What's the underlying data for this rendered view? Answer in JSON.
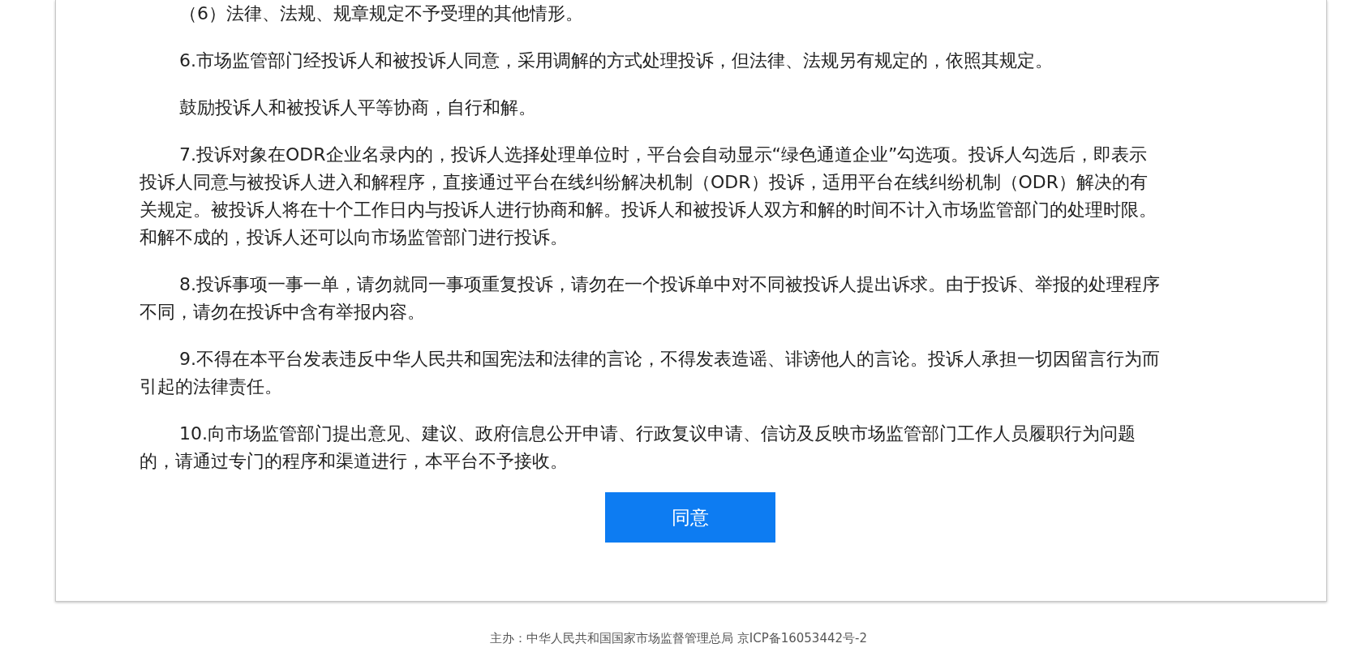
{
  "paragraphs": [
    {
      "lines": [
        "（6）法律、法规、规章规定不予受理的其他情形。"
      ]
    },
    {
      "lines": [
        "6.市场监管部门经投诉人和被投诉人同意，采用调解的方式处理投诉，但法律、法规另有规定的，依照其规定。"
      ]
    },
    {
      "lines": [
        "鼓励投诉人和被投诉人平等协商，自行和解。"
      ]
    },
    {
      "lines": [
        "7.投诉对象在ODR企业名录内的，投诉人选择处理单位时，平台会自动显示“绿色通道企业”勾选项。投诉人勾选后，即表示",
        "投诉人同意与被投诉人进入和解程序，直接通过平台在线纠纷解决机制（ODR）投诉，适用平台在线纠纷机制（ODR）解决的有",
        "关规定。被投诉人将在十个工作日内与投诉人进行协商和解。投诉人和被投诉人双方和解的时间不计入市场监管部门的处理时限。",
        "和解不成的，投诉人还可以向市场监管部门进行投诉。"
      ]
    },
    {
      "lines": [
        "8.投诉事项一事一单，请勿就同一事项重复投诉，请勿在一个投诉单中对不同被投诉人提出诉求。由于投诉、举报的处理程序",
        "不同，请勿在投诉中含有举报内容。"
      ]
    },
    {
      "lines": [
        "9.不得在本平台发表违反中华人民共和国宪法和法律的言论，不得发表造谣、诽谤他人的言论。投诉人承担一切因留言行为而",
        "引起的法律责任。"
      ]
    },
    {
      "lines": [
        "10.向市场监管部门提出意见、建议、政府信息公开申请、行政复议申请、信访及反映市场监管部门工作人员履职行为问题",
        "的，请通过专门的程序和渠道进行，本平台不予接收。"
      ]
    }
  ],
  "agree_button": "同意",
  "footer": "主办：中华人民共和国国家市场监督管理总局 京ICP备16053442号-2"
}
